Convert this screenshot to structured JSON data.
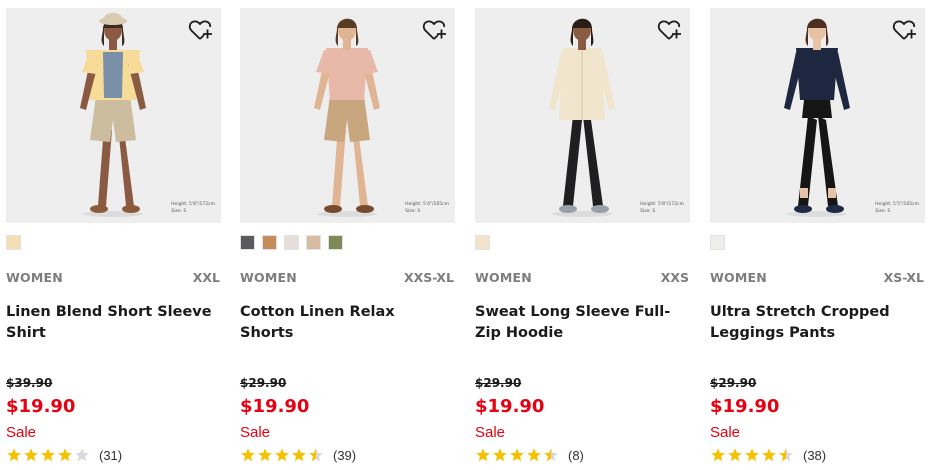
{
  "products": [
    {
      "gender": "WOMEN",
      "sizes": "XXL",
      "name": "Linen Blend Short Sleeve Shirt",
      "original_price": "$39.90",
      "price": "$19.90",
      "sale": "Sale",
      "rating": 4,
      "review_count": "(31)",
      "model_height": "Height: 5'8\"/172cm",
      "model_size": "Size: S",
      "swatches": [
        "#f3dfb2"
      ],
      "colors": {
        "top": "#f6dc98",
        "inner": "#7a8fa8",
        "bottom": "#cbbd9e",
        "shoe": "#8a5a3a",
        "skin": "#8a5a43",
        "hair": "#3b2a20",
        "hat": "#d8cbb0"
      }
    },
    {
      "gender": "WOMEN",
      "sizes": "XXS-XL",
      "name": "Cotton Linen Relax Shorts",
      "original_price": "$29.90",
      "price": "$19.90",
      "sale": "Sale",
      "rating": 4.5,
      "review_count": "(39)",
      "model_height": "Height: 5'4\"/165cm",
      "model_size": "Size: S",
      "swatches": [
        "#5c5a5f",
        "#c68b5a",
        "#e6dfd9",
        "#d8bba3",
        "#7d8a56"
      ],
      "colors": {
        "top": "#e8b8a8",
        "inner": "#e8b8a8",
        "bottom": "#c9a77e",
        "shoe": "#7a4a2e",
        "skin": "#e0b594",
        "hair": "#5a3b25",
        "hat": ""
      }
    },
    {
      "gender": "WOMEN",
      "sizes": "XXS",
      "name": "Sweat Long Sleeve Full-Zip Hoodie",
      "original_price": "$29.90",
      "price": "$19.90",
      "sale": "Sale",
      "rating": 4.5,
      "review_count": "(8)",
      "model_height": "Height: 5'8\"/172cm",
      "model_size": "Size: S",
      "swatches": [
        "#f1e3c9"
      ],
      "colors": {
        "top": "#f1e6cd",
        "inner": "#f1e6cd",
        "bottom": "#1f1f22",
        "shoe": "#9aa0a8",
        "skin": "#8b5c44",
        "hair": "#2a1d16",
        "hat": ""
      }
    },
    {
      "gender": "WOMEN",
      "sizes": "XS-XL",
      "name": "Ultra Stretch Cropped Leggings Pants",
      "original_price": "$29.90",
      "price": "$19.90",
      "sale": "Sale",
      "rating": 4.5,
      "review_count": "(38)",
      "model_height": "Height: 5'5\"/165cm",
      "model_size": "Size: S",
      "swatches": [
        "#eeeeea"
      ],
      "colors": {
        "top": "#1d2740",
        "inner": "#1d2740",
        "bottom": "#151515",
        "shoe": "#1f2a44",
        "skin": "#e8c2a4",
        "hair": "#4a2f22",
        "hat": ""
      }
    }
  ],
  "accent": "#e60012",
  "star_color": "#f6c200"
}
